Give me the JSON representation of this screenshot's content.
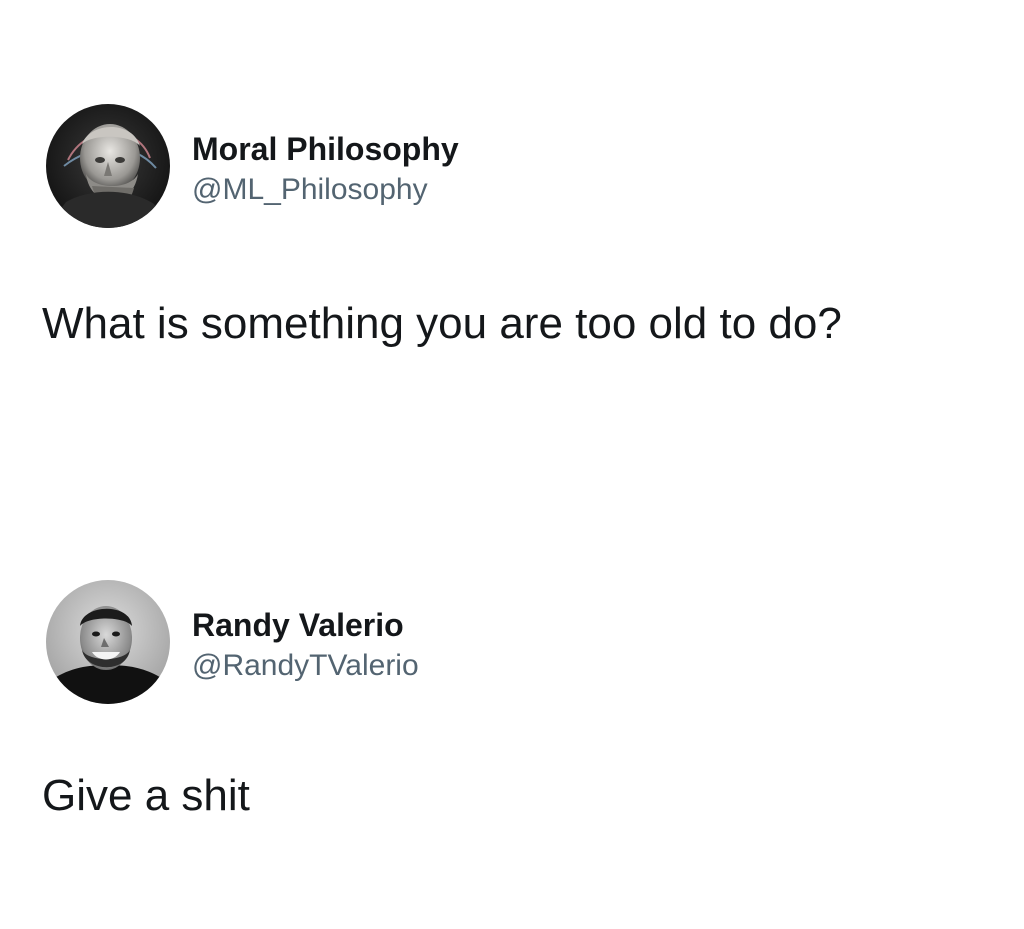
{
  "tweets": [
    {
      "display_name": "Moral Philosophy",
      "handle": "@ML_Philosophy",
      "avatar_icon": "marble-statue-avatar",
      "text": "What is something you are too old to do?"
    },
    {
      "display_name": "Randy Valerio",
      "handle": "@RandyTValerio",
      "avatar_icon": "smiling-man-avatar",
      "text": "Give a shit"
    }
  ],
  "colors": {
    "background": "#ffffff",
    "text": "#14171a",
    "handle": "#536471"
  }
}
